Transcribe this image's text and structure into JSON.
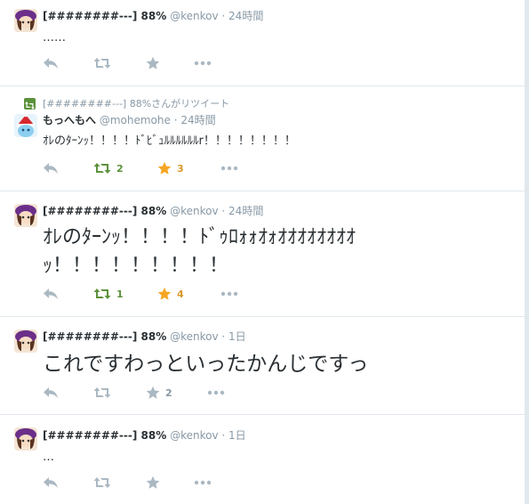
{
  "tweets": [
    {
      "name": "[########---] 88%",
      "handle": "@kenkov",
      "dot": "·",
      "time": "24時間",
      "text_lines": [
        "……"
      ],
      "retweets": "",
      "favorites": ""
    },
    {
      "context": "[########---] 88%さんがリツイート",
      "name": "もっへもへ",
      "handle": "@mohemohe",
      "dot": "·",
      "time": "24時間",
      "text_lines": [
        "ｵﾚのﾀｰﾝｯ！！！！ﾄﾞﾋﾞｭﾙﾙﾙﾙﾙﾙr！！！！！！！！"
      ],
      "retweets": "2",
      "favorites": "3"
    },
    {
      "name": "[########---] 88%",
      "handle": "@kenkov",
      "dot": "·",
      "time": "24時間",
      "text_lines": [
        "ｵﾚのﾀｰﾝｯ！！！！ﾄﾞｩﾛｫｫｵｫｵｵｵｵｵｵｵｵ",
        "ｯ！！！！！！！！！"
      ],
      "retweets": "1",
      "favorites": "4"
    },
    {
      "name": "[########---] 88%",
      "handle": "@kenkov",
      "dot": "·",
      "time": "1日",
      "text_lines": [
        "これですわっといったかんじですっ"
      ],
      "retweets": "",
      "favorites": "2"
    },
    {
      "name": "[########---] 88%",
      "handle": "@kenkov",
      "dot": "·",
      "time": "1日",
      "text_lines": [
        "…"
      ],
      "retweets": "",
      "favorites": ""
    }
  ],
  "colors": {
    "muted": "#8899a6",
    "retweet_active": "#5c913b",
    "favorite_active": "#d99a2b",
    "border": "#e1e8ed"
  }
}
